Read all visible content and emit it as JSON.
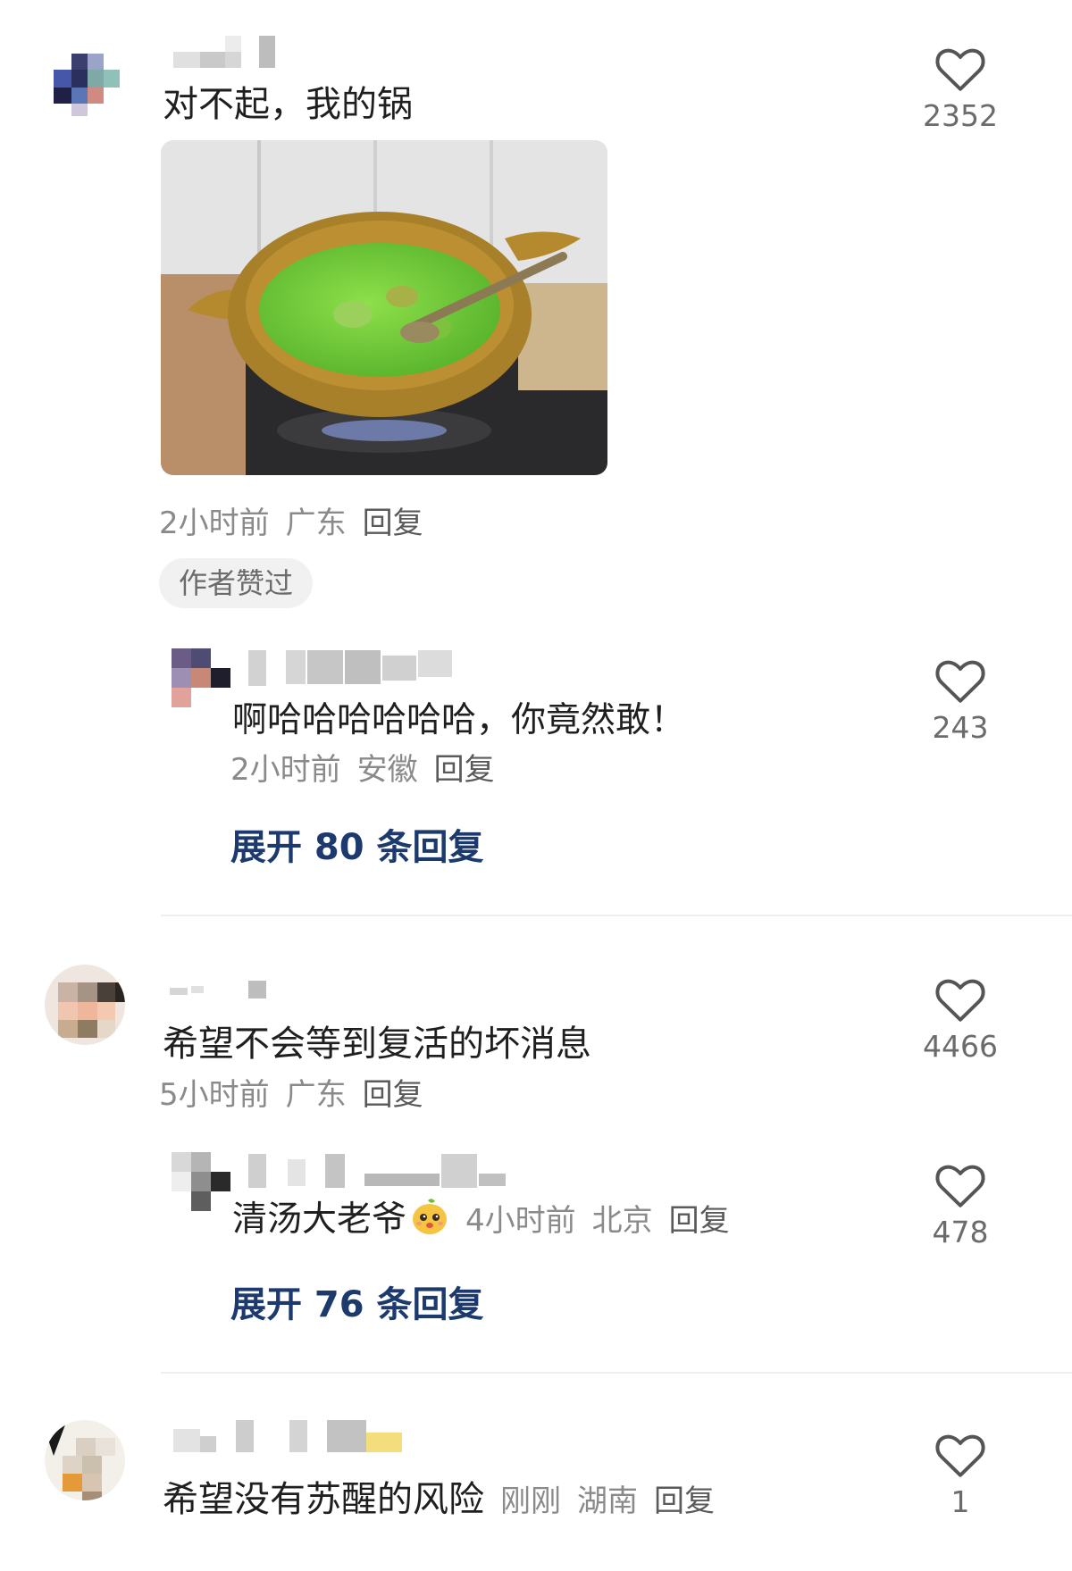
{
  "comments": [
    {
      "text": "对不起，我的锅",
      "time": "2小时前",
      "location": "广东",
      "reply_label": "回复",
      "likes": "2352",
      "badge": "作者赞过",
      "reply": {
        "text": "啊哈哈哈哈哈哈，你竟然敢！",
        "time": "2小时前",
        "location": "安徽",
        "reply_label": "回复",
        "likes": "243"
      },
      "expand_label": "展开 80 条回复"
    },
    {
      "text": "希望不会等到复活的坏消息",
      "time": "5小时前",
      "location": "广东",
      "reply_label": "回复",
      "likes": "4466",
      "reply": {
        "text": "清汤大老爷",
        "emoji": "mango-emoji-icon",
        "time": "4小时前",
        "location": "北京",
        "reply_label": "回复",
        "likes": "478"
      },
      "expand_label": "展开 76 条回复"
    },
    {
      "text": "希望没有苏醒的风险",
      "time": "刚刚",
      "location": "湖南",
      "reply_label": "回复",
      "likes": "1"
    }
  ],
  "colors": {
    "text": "#1f1f1f",
    "meta": "#8a8a8a",
    "expand_link": "#1c3a6e",
    "badge_bg": "#f1f1f1",
    "heart_outline": "#555555"
  },
  "icons": [
    "heart-outline-icon",
    "mango-emoji-icon"
  ]
}
